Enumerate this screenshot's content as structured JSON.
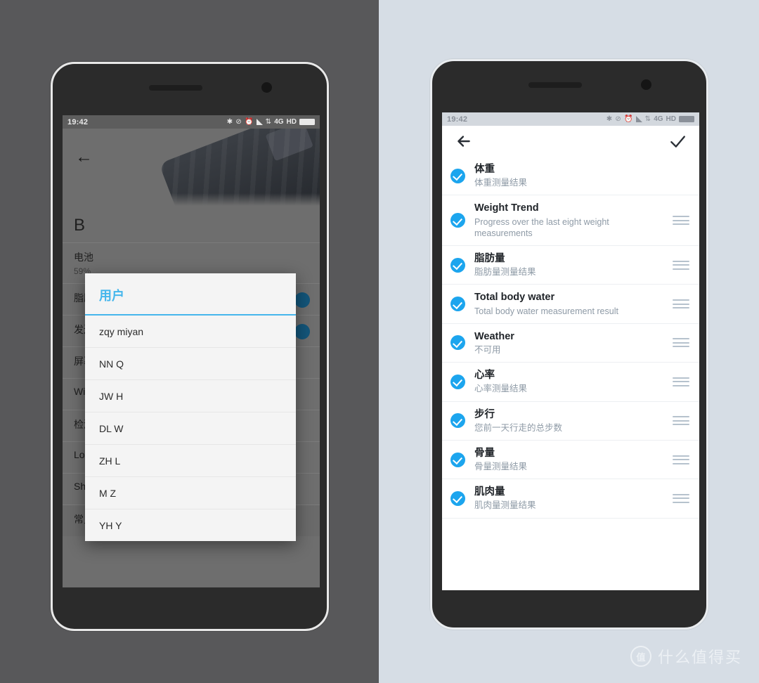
{
  "background": {
    "left_color": "#58585a",
    "right_color": "#d6dde5"
  },
  "accent": {
    "blue": "#1ca5ee",
    "dialog_blue": "#45b6ec",
    "toggle_blue": "#13557a"
  },
  "left_phone": {
    "statusbar": {
      "time": "19:42",
      "icons": [
        "bluetooth",
        "mute",
        "alarm",
        "signal",
        "data",
        "4G",
        "HD",
        "battery"
      ],
      "network_4g": "4G",
      "network_hd": "HD"
    },
    "appbar": {
      "back_icon": "back-arrow"
    },
    "page_title": "B",
    "rows": [
      {
        "main": "电池",
        "sub": "59%"
      },
      {
        "main": "脂肪",
        "sub": "",
        "toggle": true
      },
      {
        "main": "发送",
        "sub": "",
        "toggle": true
      },
      {
        "main": "屏幕",
        "sub": ""
      },
      {
        "main": "Wi-",
        "sub": ""
      },
      {
        "main": "检测",
        "sub": ""
      },
      {
        "main": "Location of your scale",
        "sub": ""
      },
      {
        "main": "Share your scale",
        "sub": ""
      },
      {
        "main": "常见问题与解答",
        "sub": ""
      }
    ],
    "dialog": {
      "title": "用户",
      "items": [
        {
          "label": "zqy miyan"
        },
        {
          "label": "NN Q"
        },
        {
          "label": "JW H"
        },
        {
          "label": "DL W"
        },
        {
          "label": "ZH L"
        },
        {
          "label": "M Z"
        },
        {
          "label": "YH Y"
        }
      ]
    }
  },
  "right_phone": {
    "statusbar": {
      "time": "19:42",
      "network_4g": "4G",
      "network_hd": "HD"
    },
    "appbar": {
      "back_icon": "back-arrow",
      "confirm_icon": "checkmark"
    },
    "items": [
      {
        "title": "体重",
        "subtitle": "体重测量结果",
        "checked": true,
        "handle": false
      },
      {
        "title": "Weight Trend",
        "subtitle": "Progress over the last eight weight measurements",
        "checked": true,
        "handle": true
      },
      {
        "title": "脂肪量",
        "subtitle": "脂肪量测量结果",
        "checked": true,
        "handle": true
      },
      {
        "title": "Total body water",
        "subtitle": "Total body water measurement result",
        "checked": true,
        "handle": true
      },
      {
        "title": "Weather",
        "subtitle": "不可用",
        "checked": true,
        "handle": true
      },
      {
        "title": "心率",
        "subtitle": "心率测量结果",
        "checked": true,
        "handle": true
      },
      {
        "title": "步行",
        "subtitle": "您前一天行走的总步数",
        "checked": true,
        "handle": true
      },
      {
        "title": "骨量",
        "subtitle": "骨量测量结果",
        "checked": true,
        "handle": true
      },
      {
        "title": "肌肉量",
        "subtitle": "肌肉量测量结果",
        "checked": true,
        "handle": true
      }
    ]
  },
  "watermark": {
    "logo": "值",
    "text": "什么值得买"
  }
}
